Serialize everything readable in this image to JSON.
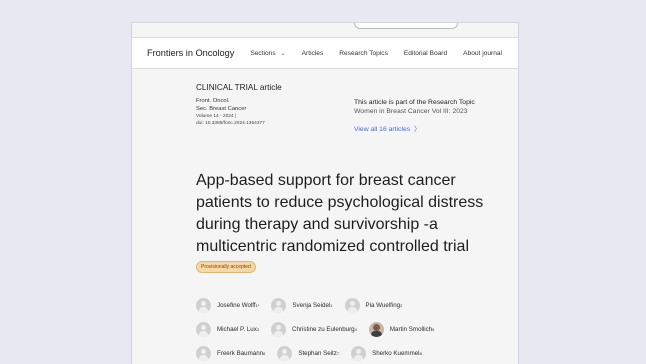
{
  "nav": {
    "brand": "Frontiers in Oncology",
    "items": [
      "Sections",
      "Articles",
      "Research Topics",
      "Editorial Board",
      "About journal"
    ]
  },
  "article": {
    "type": "CLINICAL TRIAL article",
    "journal": "Front. Oncol.",
    "section": "Sec. Breast Cancer",
    "volume": "Volume 14 - 2024 |",
    "doi": "doi: 10.3389/fonc.2024.1354377",
    "title": "App-based support for breast cancer patients to reduce psychological distress during therapy and survivorship -a multicentric randomized controlled trial",
    "badge": "Provisionally accepted"
  },
  "topic": {
    "line1": "This article is part of the Research Topic",
    "line2": "Women in Breast Cancer Vol III: 2023",
    "link": "View all 16 articles",
    "link_icon": "chevron-right-icon"
  },
  "authors": [
    {
      "name": "Josefine Wolff",
      "sup": "1*",
      "photo": false
    },
    {
      "name": "Svenja Seidel",
      "sup": "1",
      "photo": false
    },
    {
      "name": "Pia Wuelfing",
      "sup": "2",
      "photo": false
    },
    {
      "name": "Michael P. Lux",
      "sup": "3",
      "photo": false
    },
    {
      "name": "Christine zu Eulenburg",
      "sup": "4",
      "photo": false
    },
    {
      "name": "Martin Smollich",
      "sup": "5",
      "photo": true
    },
    {
      "name": "Freerk Baumann",
      "sup": "6",
      "photo": false
    },
    {
      "name": "Stephan Seitz",
      "sup": "7",
      "photo": false
    },
    {
      "name": "Sherko Kuemmel",
      "sup": "8",
      "photo": false
    }
  ],
  "colors": {
    "link": "#3f6fd6",
    "badge": "#f6d7a8",
    "background": "#e7e8f1"
  }
}
